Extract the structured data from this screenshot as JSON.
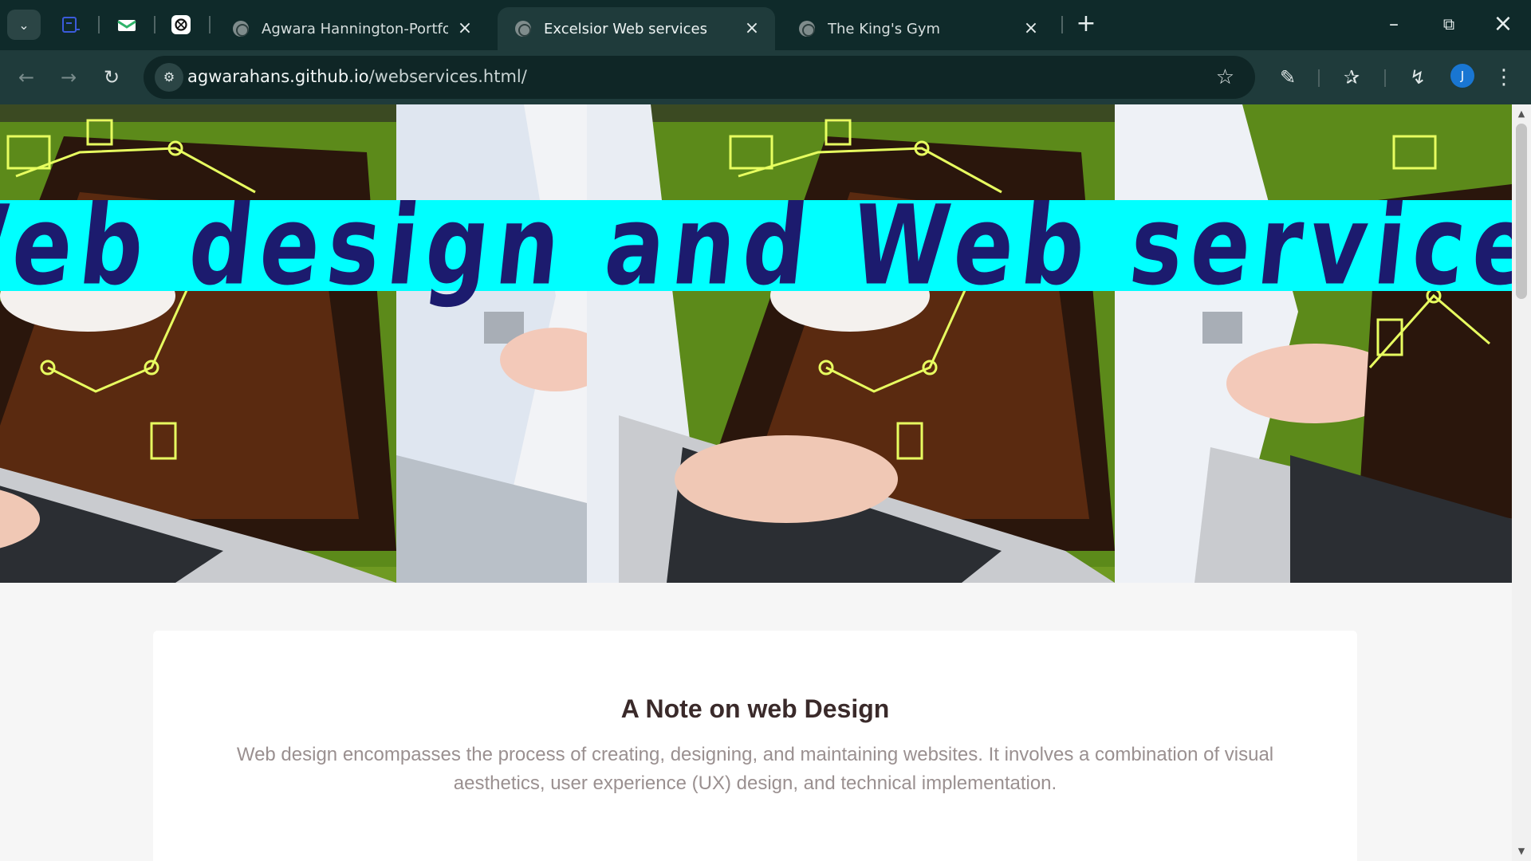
{
  "browser": {
    "tabs": [
      {
        "title": "Agwara Hannington-Portfolio",
        "active": false
      },
      {
        "title": "Excelsior Web services",
        "active": true
      },
      {
        "title": "The King's Gym",
        "active": false
      }
    ],
    "url_host": "agwarahans.github.io",
    "url_path": "/webservices.html/",
    "profile_initial": "J"
  },
  "page": {
    "hero_title": "Web design and Web services",
    "note_title": "A Note on web Design",
    "note_body": "Web design encompasses the process of creating, designing, and maintaining websites. It involves a combination of visual aesthetics, user experience (UX) design, and technical implementation."
  },
  "colors": {
    "chrome_dark": "#0f2a2a",
    "chrome_toolbar": "#1f3b3b",
    "hero_band": "#00ffff",
    "hero_text": "#1c1b6e",
    "page_bg": "#f6f6f6",
    "note_title": "#3a2a2a",
    "note_body": "#9a9090"
  },
  "icons": [
    "tab-search-icon",
    "pinned-docs-icon",
    "pinned-mail-icon",
    "pinned-chatgpt-icon",
    "globe-icon",
    "close-icon",
    "plus-icon",
    "minimize-icon",
    "restore-icon",
    "back-arrow-icon",
    "forward-arrow-icon",
    "reload-icon",
    "site-info-icon",
    "star-icon",
    "extensions-icon",
    "bookmarks-icon",
    "performance-icon",
    "more-vertical-icon"
  ]
}
